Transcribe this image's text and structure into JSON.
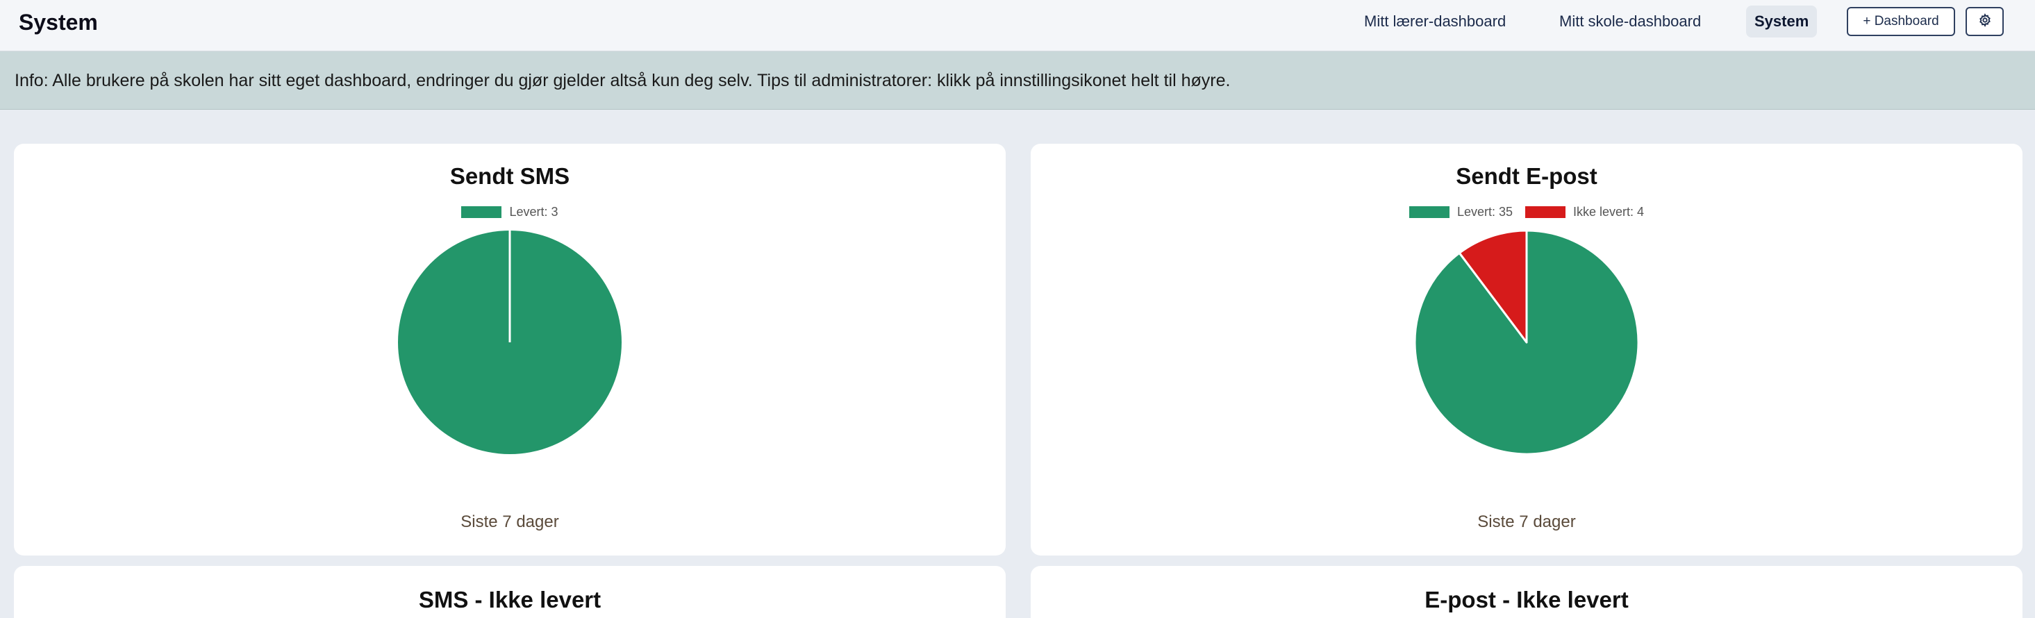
{
  "header": {
    "title": "System",
    "nav": [
      {
        "label": "Mitt lærer-dashboard"
      },
      {
        "label": "Mitt skole-dashboard"
      },
      {
        "label": "System"
      }
    ],
    "add_dashboard_label": "+ Dashboard",
    "settings_icon": "gear-icon"
  },
  "info": {
    "text": "Info: Alle brukere på skolen har sitt eget dashboard, endringer du gjør gjelder altså kun deg selv. Tips til administratorer: klikk på innstillingsikonet helt til høyre."
  },
  "colors": {
    "delivered": "#23966a",
    "not_delivered": "#d61b1b",
    "info_bg": "#c9d8d9"
  },
  "cards": [
    {
      "title": "Sendt SMS",
      "footer": "Siste 7 dager",
      "legend": [
        "Levert: 3"
      ]
    },
    {
      "title": "Sendt E-post",
      "footer": "Siste 7 dager",
      "legend": [
        "Levert: 35",
        "Ikke levert: 4"
      ]
    },
    {
      "title": "SMS - Ikke levert"
    },
    {
      "title": "E-post - Ikke levert"
    }
  ],
  "chart_data": [
    {
      "type": "pie",
      "title": "Sendt SMS",
      "categories": [
        "Levert"
      ],
      "values": [
        3
      ],
      "colors": [
        "#23966a"
      ],
      "legend": "top-center"
    },
    {
      "type": "pie",
      "title": "Sendt E-post",
      "categories": [
        "Levert",
        "Ikke levert"
      ],
      "values": [
        35,
        4
      ],
      "colors": [
        "#23966a",
        "#d61b1b"
      ],
      "legend": "top-center"
    }
  ]
}
